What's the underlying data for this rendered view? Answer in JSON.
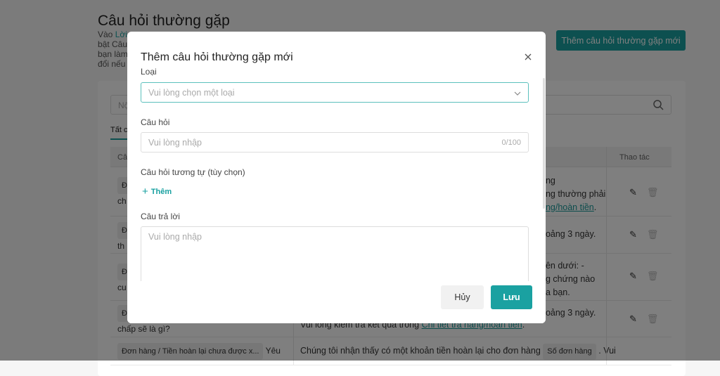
{
  "page": {
    "title": "Câu hỏi thường gặp",
    "desc_fragments": [
      "Vào",
      "Lời",
      "bật Câu",
      "bạn làm",
      "đổi nếu"
    ],
    "add_button": "Thêm câu hỏi thường gặp mới",
    "search_placeholder_fragment": "Nộ",
    "tab_fragment": "Tất c",
    "table": {
      "headers": [
        "Câ",
        "Thao tác"
      ],
      "rows": [
        {
          "q": [
            "Đ",
            "ch"
          ],
          "a": [
            "àng",
            "ộng thường phải"
          ],
          "link": "àng/hoàn tiền",
          "link_suffix": "."
        },
        {
          "q": [
            "Đ",
            "th"
          ],
          "a": [
            "hoảng 3 ngày."
          ]
        },
        {
          "q": [
            "Đ",
            "cu"
          ],
          "a": [
            "bên dưới: -",
            "ng chứng nào",
            "ủa bạn."
          ]
        },
        {
          "q": [
            "Đ",
            "chấp sẽ là gì?"
          ],
          "a": [
            "hoảng 3 ngày."
          ],
          "a2": "Vui lòng kiểm tra kết quả trong",
          "link": "Chi tiết trả hàng/hoàn tiền",
          "link_suffix": "."
        },
        {
          "tag": "Đơn hàng / Tiền hoàn lại chưa được x...",
          "q_after": "Yêu",
          "a_text": "Chúng tôi nhận thấy có một khoản tiền hoàn lại cho đơn hàng",
          "a_tag": "Số đơn hàng",
          "a_after": ". Vui"
        }
      ]
    }
  },
  "modal": {
    "title": "Thêm câu hỏi thường gặp mới",
    "type_label": "Loại",
    "type_placeholder": "Vui lòng chọn một loại",
    "question_label": "Câu hỏi",
    "question_placeholder": "Vui lòng nhập",
    "question_counter": "0/100",
    "similar_label": "Câu hỏi tương tự (tùy chọn)",
    "add_similar": "Thêm",
    "answer_label": "Câu trả lời",
    "answer_placeholder": "Vui lòng nhập",
    "cancel": "Hủy",
    "save": "Lưu"
  },
  "colors": {
    "accent": "#1aa1a1",
    "overlay": "rgba(0,0,0,0.5)"
  }
}
